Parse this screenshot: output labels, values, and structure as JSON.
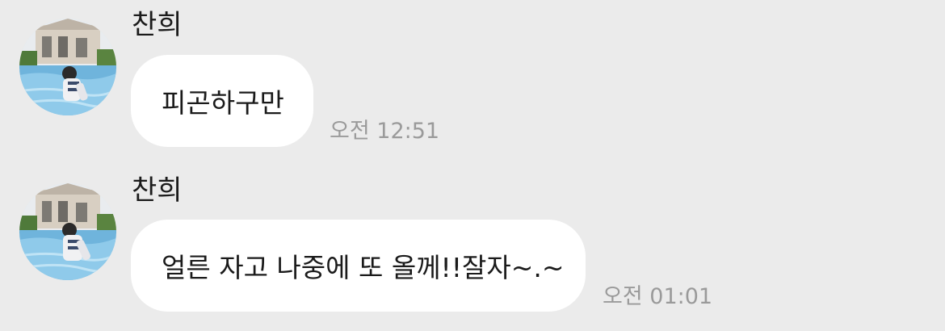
{
  "messages": [
    {
      "sender": "찬희",
      "avatar_icon": "profile-photo-pool",
      "text": "피곤하구만",
      "time": "오전 12:51"
    },
    {
      "sender": "찬희",
      "avatar_icon": "profile-photo-pool",
      "text": "얼른 자고 나중에 또 올께!!잘자~.~",
      "time": "오전 01:01"
    }
  ],
  "colors": {
    "background": "#ebebeb",
    "bubble": "#ffffff",
    "timestamp": "#9a9a9a"
  }
}
